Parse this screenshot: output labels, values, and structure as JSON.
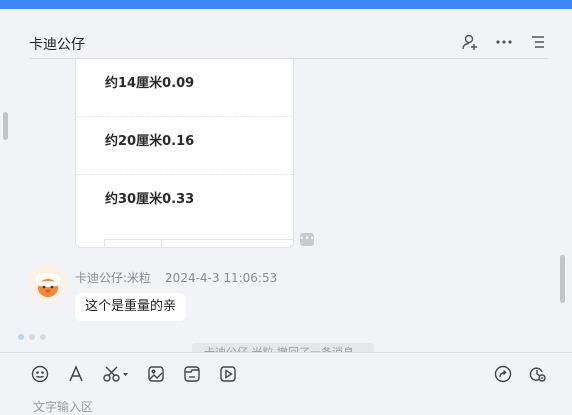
{
  "chat": {
    "title": "卡迪公仔"
  },
  "header_icons": [
    "add-user-icon",
    "more-icon",
    "list-icon"
  ],
  "card": {
    "items": [
      {
        "label": "约14厘米0.09"
      },
      {
        "label": "约20厘米0.16"
      },
      {
        "label": "约30厘米0.33"
      }
    ]
  },
  "message": {
    "sender": "卡迪公仔:米粒",
    "time": "2024-4-3 11:06:53",
    "text": "这个是重量的亲"
  },
  "notice": {
    "text": "卡迪公仔 米粒 撤回了一条消息"
  },
  "toolbar": {
    "icons": [
      "emoji-icon",
      "font-icon",
      "scissors-icon",
      "image-icon",
      "file-icon",
      "video-icon",
      "share-icon",
      "history-icon"
    ],
    "placeholder": "文字输入区"
  }
}
